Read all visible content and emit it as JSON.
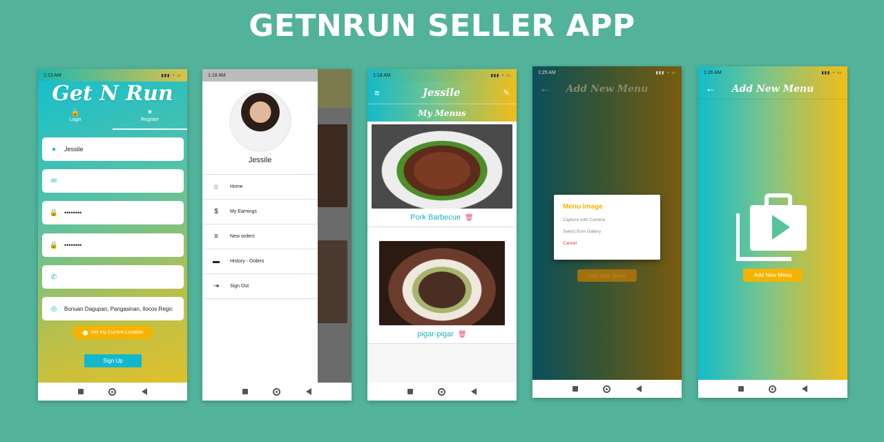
{
  "banner": {
    "title": "GETNRUN SELLER APP"
  },
  "phone1": {
    "status_time": "1:13 AM",
    "app_title": "Get N Run",
    "tabs": [
      {
        "label": "Login"
      },
      {
        "label": "Register"
      }
    ],
    "fields": [
      {
        "value": "Jessile",
        "icon": "person-icon"
      },
      {
        "value": "",
        "icon": "email-icon"
      },
      {
        "value": "••••••••",
        "icon": "lock-icon"
      },
      {
        "value": "••••••••",
        "icon": "lock-icon"
      },
      {
        "value": "",
        "icon": "phone-icon"
      },
      {
        "value": "Bonuan Dagupan, Pangasinan, Ilocos Regic",
        "icon": "location-icon"
      }
    ],
    "location_button": "Get my Current Location",
    "signup_button": "Sign Up"
  },
  "phone2": {
    "status_time": "1:18 AM",
    "user_name": "Jessile",
    "menu": [
      {
        "label": "Home",
        "icon": "home-icon"
      },
      {
        "label": "My Earnings",
        "icon": "dollar-icon"
      },
      {
        "label": "New orders",
        "icon": "list-icon"
      },
      {
        "label": "History - Orders",
        "icon": "truck-icon"
      },
      {
        "label": "Sign Out",
        "icon": "exit-icon"
      }
    ]
  },
  "phone3": {
    "status_time": "1:18 AM",
    "title": "Jessile",
    "subtitle": "My Menus",
    "menus": [
      {
        "name": "Pork Barbecue"
      },
      {
        "name": "pigar-pigar"
      }
    ]
  },
  "phone4": {
    "status_time": "1:25 AM",
    "title": "Add New Menu",
    "dialog": {
      "title": "Menu Image",
      "option1": "Capture with Camera",
      "option2": "Select from Gallery",
      "cancel": "Cancel"
    },
    "button": "Add New Menu"
  },
  "phone5": {
    "status_time": "1:26 AM",
    "title": "Add New Menu",
    "button": "Add New Menu"
  },
  "colors": {
    "background": "#52b29a",
    "accent": "#13b8cc",
    "yellow": "#f4b400"
  }
}
